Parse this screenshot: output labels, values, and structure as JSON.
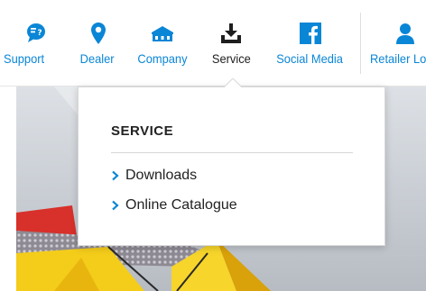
{
  "nav": {
    "items": [
      {
        "label": "Support",
        "icon": "chat-question-icon"
      },
      {
        "label": "Dealer",
        "icon": "map-pin-icon"
      },
      {
        "label": "Company",
        "icon": "building-icon"
      },
      {
        "label": "Service",
        "icon": "download-tray-icon",
        "active": true
      },
      {
        "label": "Social Media",
        "icon": "facebook-icon"
      },
      {
        "label": "Retailer Lo",
        "icon": "user-icon"
      }
    ]
  },
  "dropdown": {
    "title": "SERVICE",
    "items": [
      {
        "label": "Downloads"
      },
      {
        "label": "Online Catalogue"
      }
    ]
  },
  "colors": {
    "accent": "#0a86d6",
    "active_text": "#1e1e1e",
    "dropdown_text": "#222222"
  }
}
